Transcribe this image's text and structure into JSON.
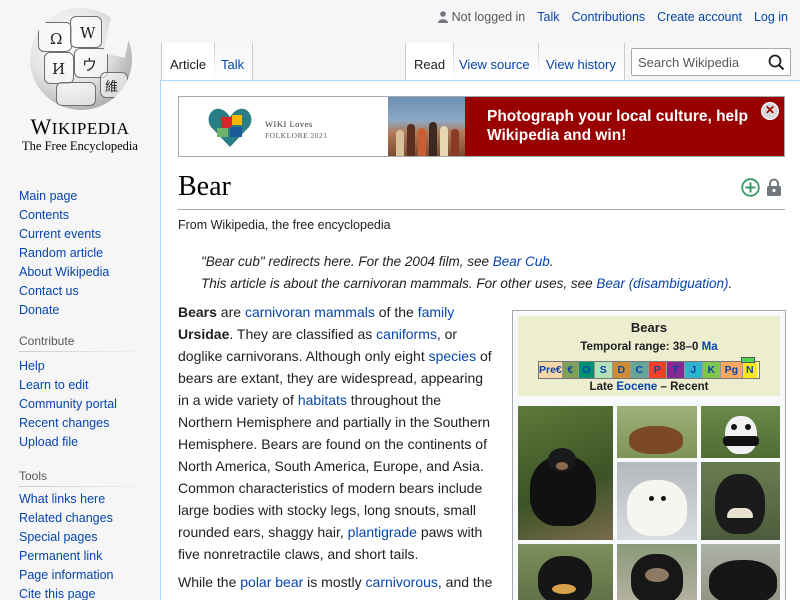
{
  "logo": {
    "wordmark_first": "W",
    "wordmark_rest": "IKIPEDIA",
    "tagline": "The Free Encyclopedia",
    "glyphs": [
      "Ω",
      "W",
      "И",
      "ウ",
      "維"
    ]
  },
  "personal_tools": {
    "status": "Not logged in",
    "talk": "Talk",
    "contributions": "Contributions",
    "create_account": "Create account",
    "login": "Log in"
  },
  "tabs": {
    "article": "Article",
    "talk": "Talk",
    "read": "Read",
    "view_source": "View source",
    "view_history": "View history"
  },
  "search": {
    "placeholder": "Search Wikipedia"
  },
  "sidebar": {
    "nav": [
      "Main page",
      "Contents",
      "Current events",
      "Random article",
      "About Wikipedia",
      "Contact us",
      "Donate"
    ],
    "contribute_heading": "Contribute",
    "contribute": [
      "Help",
      "Learn to edit",
      "Community portal",
      "Recent changes",
      "Upload file"
    ],
    "tools_heading": "Tools",
    "tools": [
      "What links here",
      "Related changes",
      "Special pages",
      "Permanent link",
      "Page information",
      "Cite this page"
    ]
  },
  "banner": {
    "campaign_title": "WIKI Loves",
    "campaign_sub": "FOLKLORE 2021",
    "message_line1": "Photograph your local culture, help",
    "message_line2": "Wikipedia and win!"
  },
  "article": {
    "title": "Bear",
    "site_sub": "From Wikipedia, the free encyclopedia",
    "hatnote1_pre": "\"Bear cub\" redirects here. For the 2004 film, see ",
    "hatnote1_link": "Bear Cub",
    "hatnote1_post": ".",
    "hatnote2_pre": "This article is about the carnivoran mammals. For other uses, see ",
    "hatnote2_link": "Bear (disambiguation)",
    "hatnote2_post": ".",
    "p1": [
      {
        "t": "Bears",
        "b": true
      },
      {
        "t": " are "
      },
      {
        "t": "carnivoran mammals",
        "a": true
      },
      {
        "t": " of the "
      },
      {
        "t": "family",
        "a": true
      },
      {
        "t": " "
      },
      {
        "t": "Ursidae",
        "b": true
      },
      {
        "t": ". They are classified as "
      },
      {
        "t": "caniforms",
        "a": true
      },
      {
        "t": ", or doglike carnivorans. Although only eight "
      },
      {
        "t": "species",
        "a": true
      },
      {
        "t": " of bears are extant, they are widespread, appearing in a wide variety of "
      },
      {
        "t": "habitats",
        "a": true
      },
      {
        "t": " throughout the Northern Hemisphere and partially in the Southern Hemisphere. Bears are found on the continents of North America, South America, Europe, and Asia. Common characteristics of modern bears include large bodies with stocky legs, long snouts, small rounded ears, shaggy hair, "
      },
      {
        "t": "plantigrade",
        "a": true
      },
      {
        "t": " paws with five nonretractile claws, and short tails."
      }
    ],
    "p2": [
      {
        "t": "While the "
      },
      {
        "t": "polar bear",
        "a": true
      },
      {
        "t": " is mostly "
      },
      {
        "t": "carnivorous",
        "a": true
      },
      {
        "t": ", and the"
      }
    ]
  },
  "infobox": {
    "title": "Bears",
    "range_prefix": "Temporal range: 38–0 ",
    "range_link": "Ma",
    "timeline": [
      "Pre€",
      "€",
      "O",
      "S",
      "D",
      "C",
      "P",
      "T",
      "J",
      "K",
      "Pg",
      "N"
    ],
    "era_pre": "Late ",
    "era_link": "Eocene",
    "era_post": " – Recent"
  },
  "colors": {
    "link": "#0645ad",
    "banner_red": "#990000",
    "infobox_header": "#ededd0",
    "content_border": "#a7d7f9"
  }
}
